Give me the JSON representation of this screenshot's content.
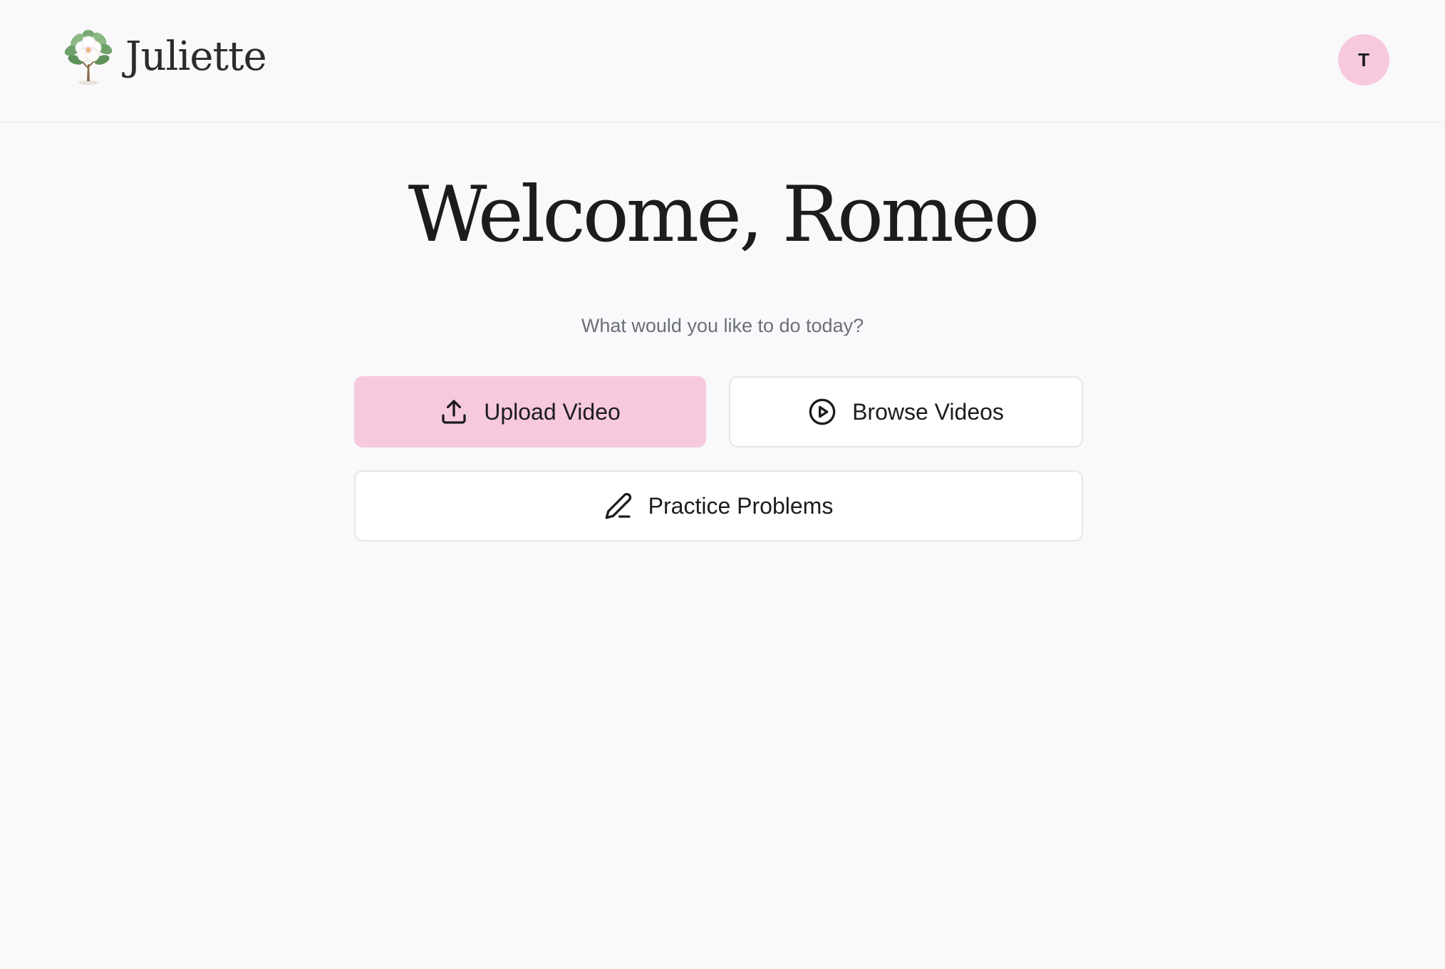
{
  "header": {
    "brand_name": "Juliette",
    "logo_icon": "magnolia-tree-icon",
    "avatar_initial": "T"
  },
  "main": {
    "welcome": "Welcome, Romeo",
    "subtitle": "What would you like to do today?",
    "actions": [
      {
        "label": "Upload Video",
        "icon": "upload-icon",
        "style": "primary"
      },
      {
        "label": "Browse Videos",
        "icon": "play-circle-icon",
        "style": "secondary"
      },
      {
        "label": "Practice Problems",
        "icon": "pencil-icon",
        "style": "secondary"
      }
    ]
  },
  "colors": {
    "background": "#f9f9fb",
    "accent_pink": "#f6c9dc",
    "text": "#1c1c1e",
    "muted_text": "#6b6f7b",
    "border": "#e6e6ea"
  }
}
